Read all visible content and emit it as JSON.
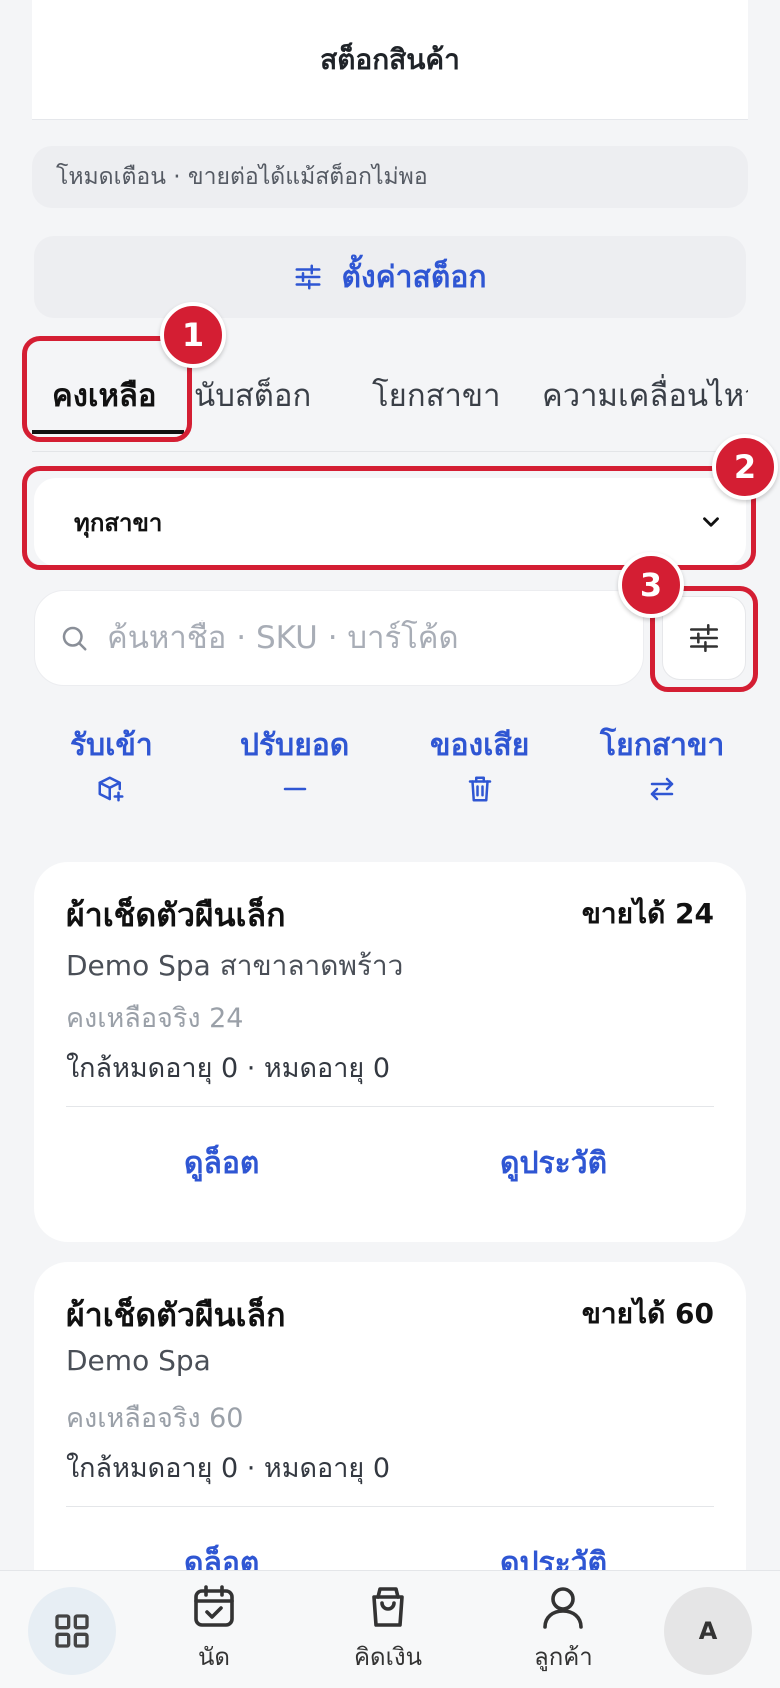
{
  "header": {
    "title": "สต็อกสินค้า"
  },
  "mode_banner": {
    "text": "โหมดเตือน · ขายต่อได้แม้สต็อกไม่พอ"
  },
  "settings_button": {
    "label": "ตั้งค่าสต็อก",
    "icon": "sliders-icon"
  },
  "tabs": [
    {
      "label": "คงเหลือ",
      "active": true
    },
    {
      "label": "นับสต็อก",
      "active": false
    },
    {
      "label": "โยกสาขา",
      "active": false
    },
    {
      "label": "ความเคลื่อนไหว",
      "active": false
    }
  ],
  "annotations": {
    "badge1": "1",
    "badge2": "2",
    "badge3": "3",
    "color": "#D41E33"
  },
  "branch_select": {
    "value": "ทุกสาขา",
    "icon": "chevron-down-icon"
  },
  "search": {
    "placeholder": "ค้นหาชื่อ · SKU · บาร์โค้ด",
    "value": "",
    "icon": "search-icon"
  },
  "filter_button": {
    "icon": "sliders-icon"
  },
  "quick_actions": [
    {
      "label": "รับเข้า",
      "icon": "box-plus-icon"
    },
    {
      "label": "ปรับยอด",
      "icon": "minus-icon"
    },
    {
      "label": "ของเสีย",
      "icon": "trash-icon"
    },
    {
      "label": "โยกสาขา",
      "icon": "swap-arrows-icon"
    }
  ],
  "cards": [
    {
      "name": "ผ้าเช็ดตัวผืนเล็ก",
      "available": "ขายได้ 24",
      "branch": "Demo Spa สาขาลาดพร้าว",
      "remaining": "คงเหลือจริง 24",
      "expiry": "ใกล้หมดอายุ 0 · หมดอายุ 0",
      "lot_link": "ดูล็อต",
      "history_link": "ดูประวัติ"
    },
    {
      "name": "ผ้าเช็ดตัวผืนเล็ก",
      "available": "ขายได้ 60",
      "branch": "Demo Spa",
      "remaining": "คงเหลือจริง 60",
      "expiry": "ใกล้หมดอายุ 0 · หมดอายุ 0",
      "lot_link": "ดูล็อต",
      "history_link": "ดูประวัติ"
    }
  ],
  "bottom_nav": {
    "home_icon": "grid-icon",
    "items": [
      {
        "label": "นัด",
        "icon": "calendar-check-icon"
      },
      {
        "label": "คิดเงิน",
        "icon": "shopping-bag-icon"
      },
      {
        "label": "ลูกค้า",
        "icon": "user-icon"
      }
    ],
    "avatar": "A"
  },
  "colors": {
    "accent": "#2F56D3",
    "background": "#F4F5F7",
    "annotation": "#D41E33"
  }
}
